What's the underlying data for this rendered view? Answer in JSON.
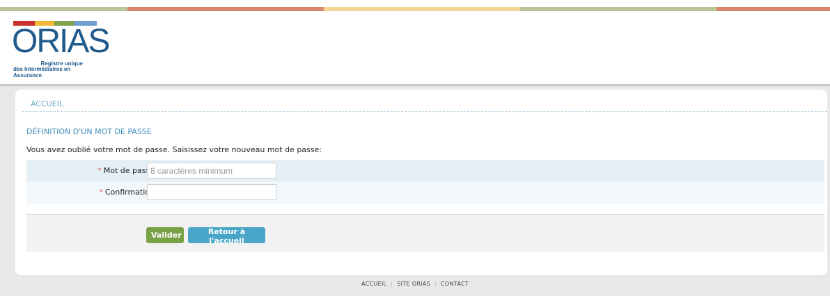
{
  "logo": {
    "name": "ORIAS",
    "tagline_line1": "Registre unique",
    "tagline_line2": "des Intermédiaires en Assurance"
  },
  "breadcrumb": "ACCUEIL",
  "section_title": "DÉFINITION D'UN MOT DE PASSE",
  "intro": "Vous avez oublié votre mot de passe. Saisissez votre nouveau mot de passe:",
  "form": {
    "password_label": "Mot de passe",
    "password_placeholder": "8 caractères minimum",
    "password_value": "",
    "confirm_label": "Confirmation",
    "confirm_value": "",
    "required_marker": "*"
  },
  "buttons": {
    "submit": "Valider",
    "back": "Retour à l'accueil"
  },
  "footer": {
    "links": [
      "Accueil",
      "Site Orias",
      "Contact"
    ],
    "separator": "|"
  },
  "colors": {
    "accent_blue": "#4aa6c9",
    "accent_green": "#79a145",
    "brand_blue": "#1f5a8c"
  }
}
